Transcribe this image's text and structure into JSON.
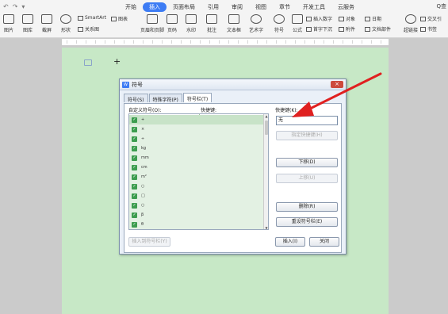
{
  "ribbon": {
    "tabs": [
      "开始",
      "插入",
      "页面布局",
      "引用",
      "审阅",
      "视图",
      "章节",
      "开发工具",
      "云服务"
    ],
    "active_tab": "插入",
    "search": "Q查",
    "tools": {
      "picture": "图片",
      "chart": "图库",
      "screenshot": "截屏",
      "shape": "形状",
      "smartart": "SmartArt",
      "icons": "图表",
      "relation": "关系图",
      "header_footer": "页眉和页脚",
      "page_number": "页码",
      "watermark": "水印",
      "comment": "批注",
      "textbox": "文本框",
      "art_text": "艺术字",
      "symbol": "符号",
      "formula": "公式",
      "insert_number": "插入数字",
      "object": "对象",
      "date": "日期",
      "drop_cap": "首字下沉",
      "attachment": "附件",
      "doc_parts": "文档部件",
      "hyperlink": "超链接",
      "bookmark": "书签",
      "cross_ref": "交叉引"
    }
  },
  "dialog": {
    "title": "符号",
    "tabs": [
      "符号(S)",
      "特殊字符(P)",
      "符号栏(T)"
    ],
    "active_tab": "符号栏(T)",
    "col_symbol": "自定义符号(O):",
    "col_hotkey": "快捷键:",
    "hotkey_label": "快捷键(K):",
    "hotkey_value": "无",
    "symbols": [
      "+",
      "×",
      "÷",
      "kg",
      "mm",
      "cm",
      "m²",
      "○",
      "□",
      "○",
      "β",
      "θ"
    ],
    "buttons": {
      "assign_hotkey": "指定快捷键(H)",
      "move_down": "下移(D)",
      "move_up": "上移(U)",
      "delete": "删除(R)",
      "reset": "重设符号栏(E)",
      "insert_to_bar": "插入到符号栏(Y)",
      "insert": "插入(I)",
      "close": "关闭"
    },
    "close_glyph": "×"
  }
}
